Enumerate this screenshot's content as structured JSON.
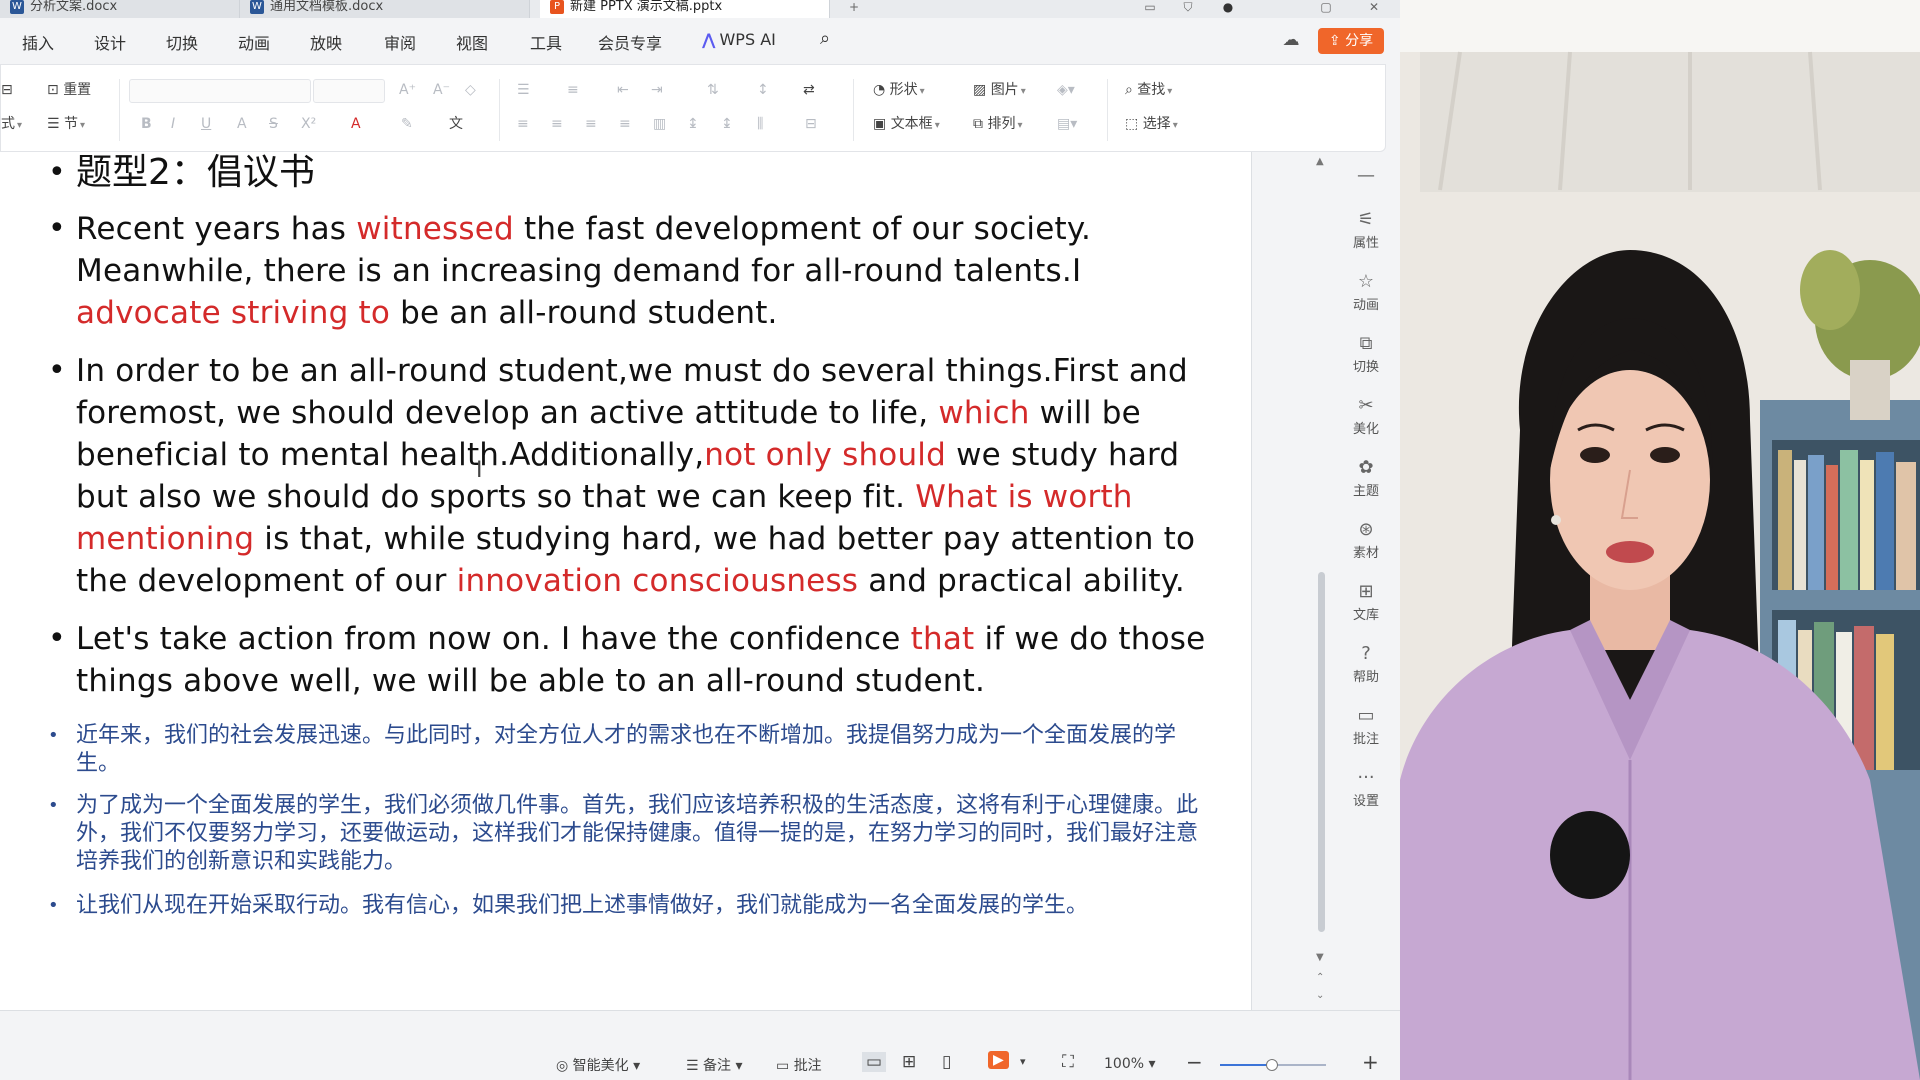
{
  "titlebar": {
    "tabs": [
      {
        "label": "分析文案.docx",
        "icon": "word-icon",
        "color": "#2b5797"
      },
      {
        "label": "通用文档模板.docx",
        "icon": "word-icon",
        "color": "#2b5797"
      },
      {
        "label": "新建 PPTX 演示文稿.pptx",
        "icon": "ppt-icon",
        "color": "#e8541e"
      }
    ]
  },
  "menu": {
    "items": [
      "插入",
      "设计",
      "切换",
      "动画",
      "放映",
      "审阅",
      "视图",
      "工具",
      "会员专享"
    ],
    "wps_ai": "WPS AI",
    "share": "分享"
  },
  "ribbon": {
    "reset": "重置",
    "layout": "式",
    "section": "节",
    "shape": "形状",
    "picture": "图片",
    "textbox": "文本框",
    "arrange": "排列",
    "find": "查找",
    "select": "选择"
  },
  "slide": {
    "heading": "题型2：倡议书",
    "p1": [
      {
        "t": "Recent years has ",
        "red": false
      },
      {
        "t": "witnessed",
        "red": true
      },
      {
        "t": " the fast development of our society. Meanwhile, there is an increasing demand for all-round talents.I ",
        "red": false
      },
      {
        "t": "advocate striving to",
        "red": true
      },
      {
        "t": " be an all-round student.",
        "red": false
      }
    ],
    "p2": [
      {
        "t": "In order to be an all-round student,we must do several things.First and foremost, we should develop an active attitude to life, ",
        "red": false
      },
      {
        "t": "which",
        "red": true
      },
      {
        "t": " will be beneficial to mental health.Additionally,",
        "red": false
      },
      {
        "t": "not only should",
        "red": true
      },
      {
        "t": " we study hard but also we should do sports so that we can keep fit. ",
        "red": false
      },
      {
        "t": "What is worth mentioning",
        "red": true
      },
      {
        "t": " is that, while studying hard, we had better pay attention to the development of our ",
        "red": false
      },
      {
        "t": "innovation consciousness",
        "red": true
      },
      {
        "t": " and practical ability.",
        "red": false
      }
    ],
    "p3": [
      {
        "t": "Let's take action from now on. I have the confidence ",
        "red": false
      },
      {
        "t": "that",
        "red": true
      },
      {
        "t": " if we do those things above well, we will be able to an all-round student.",
        "red": false
      }
    ],
    "zh1": "近年来，我们的社会发展迅速。与此同时，对全方位人才的需求也在不断增加。我提倡努力成为一个全面发展的学生。",
    "zh2": "为了成为一个全面发展的学生，我们必须做几件事。首先，我们应该培养积极的生活态度，这将有利于心理健康。此外，我们不仅要努力学习，还要做运动，这样我们才能保持健康。值得一提的是，在努力学习的同时，我们最好注意培养我们的创新意识和实践能力。",
    "zh3": "让我们从现在开始采取行动。我有信心，如果我们把上述事情做好，我们就能成为一名全面发展的学生。"
  },
  "side_panel": [
    "属性",
    "动画",
    "切换",
    "美化",
    "主题",
    "素材",
    "文库",
    "帮助",
    "批注",
    "设置"
  ],
  "status": {
    "beautify": "智能美化",
    "notes": "备注",
    "comments": "批注",
    "zoom": "100%",
    "zoom_fraction": 0.48
  },
  "colors": {
    "accent_red": "#d42a2a",
    "share": "#f0662a",
    "zh_text": "#2c4b8e"
  }
}
